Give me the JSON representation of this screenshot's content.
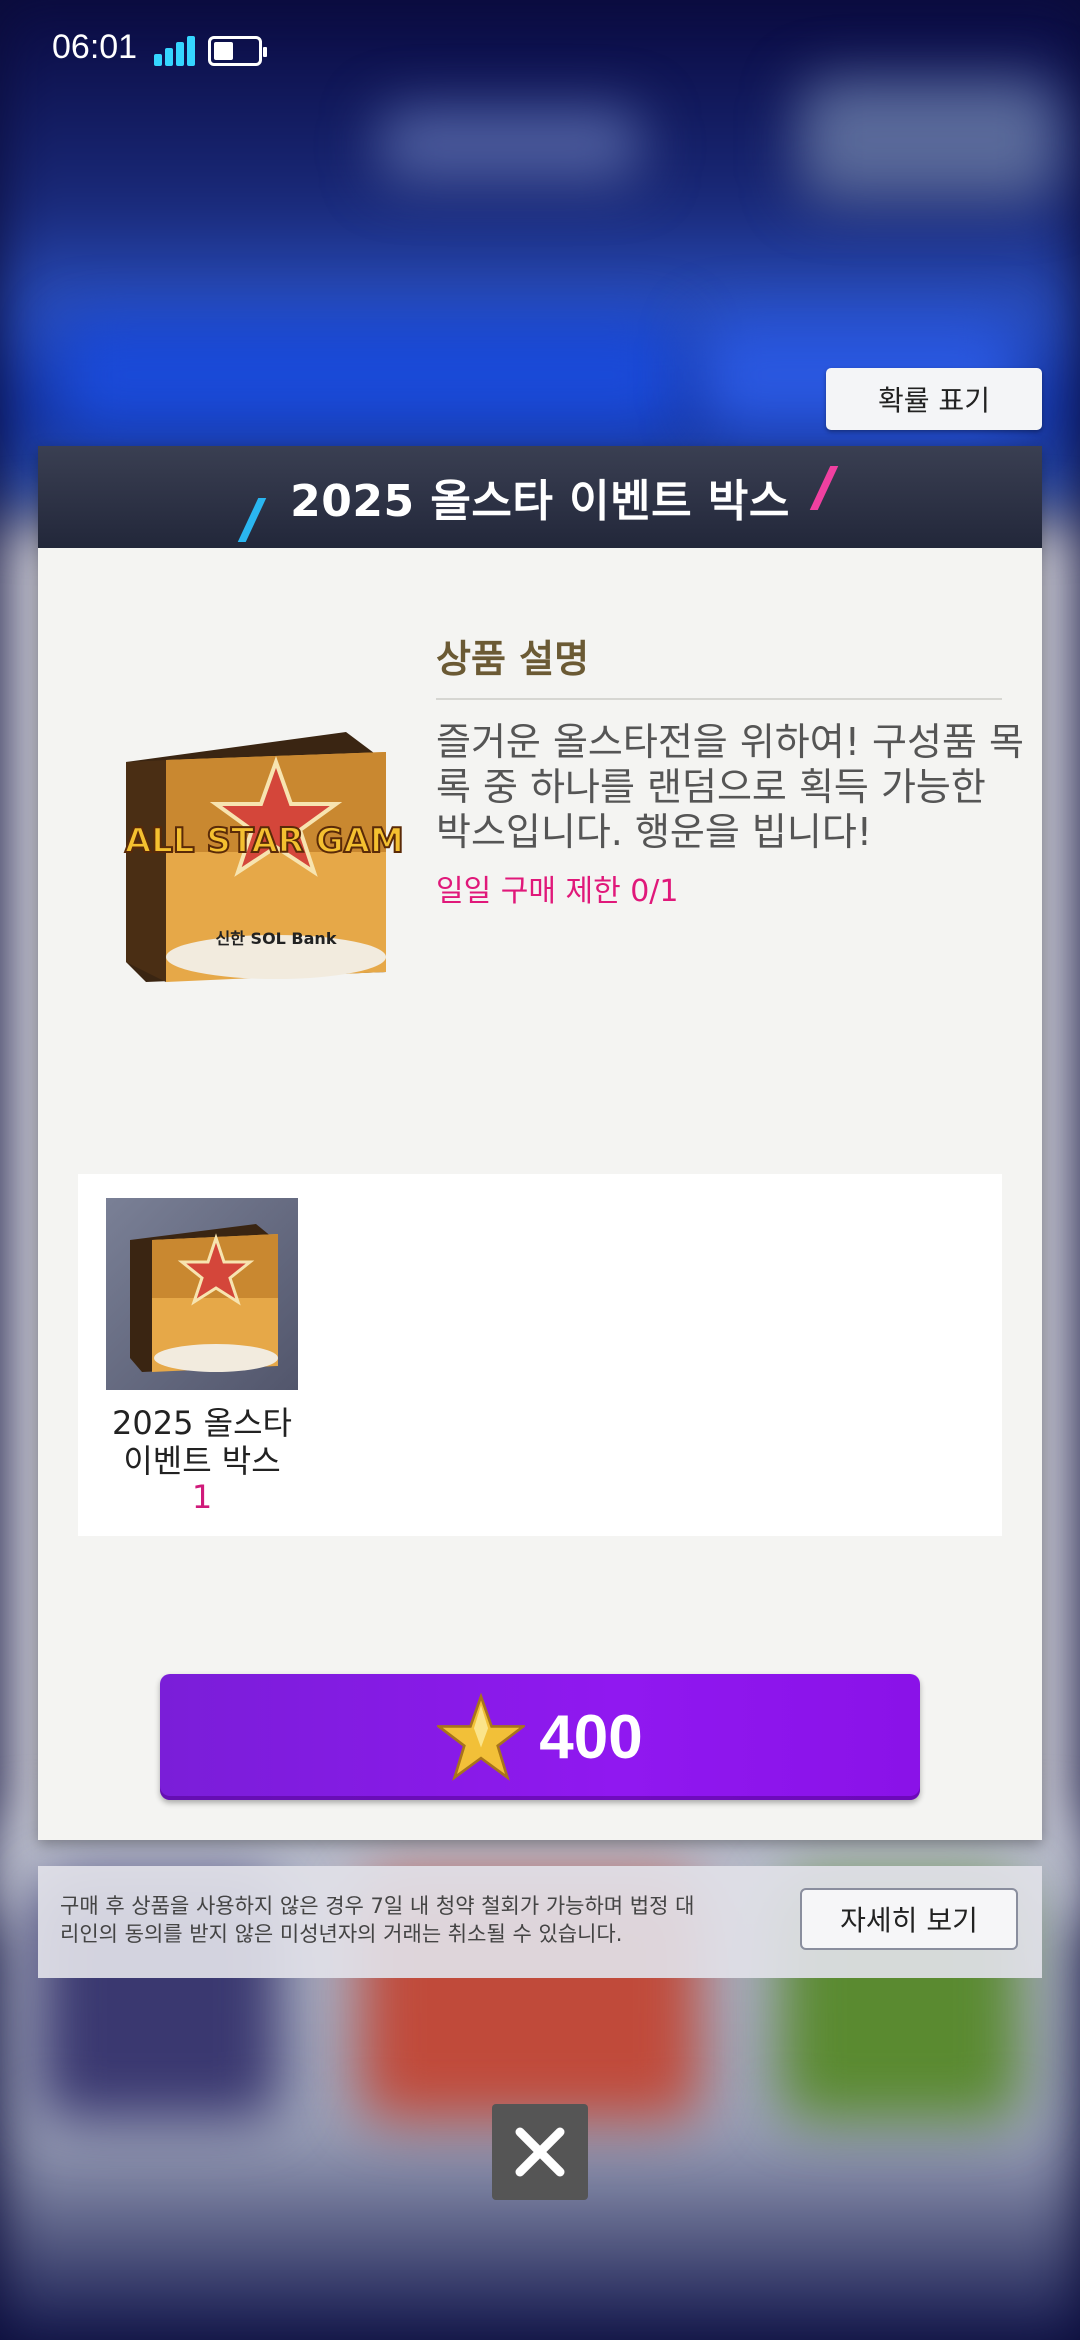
{
  "status_bar": {
    "time": "06:01",
    "battery_level": 0.45,
    "signal_bars": 4
  },
  "probability_button": {
    "label": "확률 표기"
  },
  "dialog": {
    "title": "2025 올스타 이벤트 박스",
    "description_heading": "상품 설명",
    "description": "즐거운 올스타전을 위하여! 구성품 목록 중 하나를 랜덤으로 획득 가능한 박스입니다. 행운을 빕니다!",
    "purchase_limit": "일일 구매 제한 0/1",
    "product_image": {
      "icon": "all-star-game-box-icon",
      "logo_text": "ALL STAR GAME",
      "sponsor_text": "신한 SOL Bank"
    },
    "items": [
      {
        "name": "2025 올스타 이벤트 박스",
        "count": "1",
        "icon": "all-star-game-box-icon"
      }
    ],
    "buy_button": {
      "currency_icon": "gold-star-icon",
      "price": "400"
    }
  },
  "notice": {
    "text": "구매 후 상품을 사용하지 않은 경우 7일 내 청약 철회가 가능하며 법정 대리인의 동의를 받지 않은 미성년자의 거래는 취소될 수 있습니다.",
    "detail_button": "자세히 보기"
  },
  "close_button": {
    "icon": "close-icon"
  },
  "colors": {
    "accent_purple": "#8a12e8",
    "header_dark": "#2a2f42",
    "limit_pink": "#e0187a",
    "heading_brown": "#6b5a34"
  }
}
